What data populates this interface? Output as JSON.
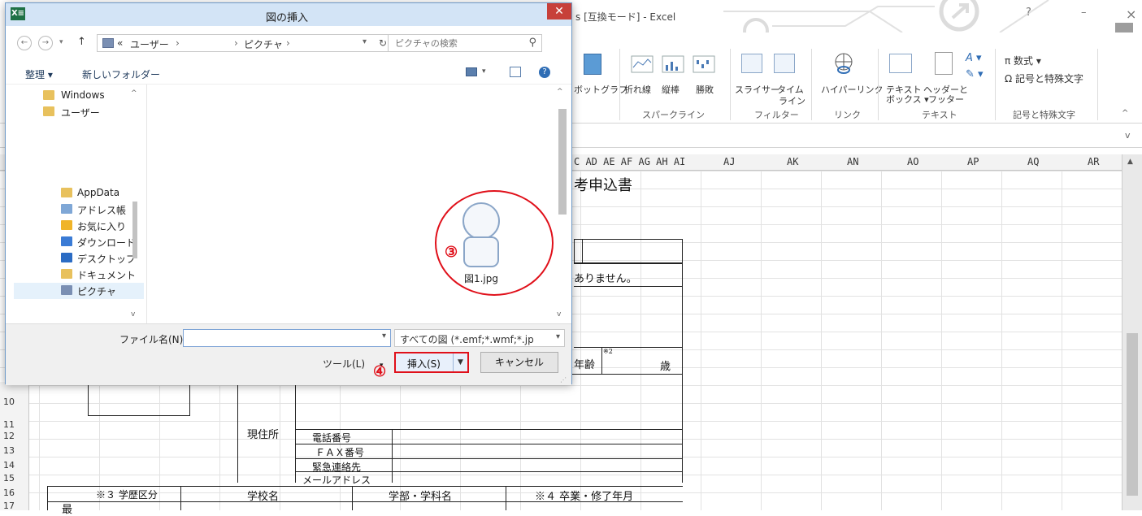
{
  "excel": {
    "title": "s [互換モード] - Excel",
    "window_controls": [
      "?",
      "–",
      "×"
    ],
    "ribbon": {
      "items": {
        "pivot_chart": "ボットグラフ",
        "line": "折れ線",
        "column": "縦棒",
        "winloss": "勝敗",
        "slicer": "スライサー",
        "timeline_1": "タイム",
        "timeline_2": "ライン",
        "hyperlink": "ハイパーリンク",
        "textbox_1": "テキスト",
        "textbox_2": "ボックス ▾",
        "header_1": "ヘッダーと",
        "header_2": "フッター",
        "equation": "π 数式 ▾",
        "symbol": "Ω 記号と特殊文字"
      },
      "groups": {
        "sparklines": "スパークライン",
        "filter": "フィルター",
        "link": "リンク",
        "text": "テキスト",
        "symbols": "記号と特殊文字"
      }
    },
    "columns_left": "C AD AE AF AG AH AI",
    "columns": [
      "AJ",
      "AK",
      "AN",
      "AO",
      "AP",
      "AQ",
      "AR"
    ],
    "rows": [
      "10",
      "11",
      "12",
      "13",
      "14",
      "15",
      "16",
      "17"
    ],
    "form": {
      "title_fragment": "考申込書",
      "notice_fragment": "ありません。",
      "age_label": "年齢",
      "age_note": "※2",
      "age_unit": "歳",
      "address_label": "現住所",
      "phone_label": "電話番号",
      "fax_label": "ＦＡＸ番号",
      "emergency_label": "緊急連絡先",
      "email_label": "メールアドレス",
      "edu_category": "※３ 学歴区分",
      "school_name": "学校名",
      "faculty": "学部・学科名",
      "graduation": "※４ 卒業・修了年月",
      "row17_char": "最"
    }
  },
  "dialog": {
    "title": "図の挿入",
    "app_icon": "X≡",
    "close": "✕",
    "nav": {
      "back": "←",
      "forward": "→",
      "up": "↑",
      "breadcrumb_prefix": "«",
      "crumb_1": "ユーザー",
      "crumb_2": "ピクチャ",
      "search_placeholder": "ピクチャの検索"
    },
    "toolbar": {
      "organize": "整理 ▾",
      "new_folder": "新しいフォルダー"
    },
    "tree": [
      "Windows",
      "ユーザー",
      "AppData",
      "アドレス帳",
      "お気に入り",
      "ダウンロード",
      "デスクトップ",
      "ドキュメント",
      "ピクチャ"
    ],
    "file": {
      "name": "図1.jpg"
    },
    "step3": "③",
    "step4": "④",
    "filename_label": "ファイル名(N):",
    "filename_value": "",
    "filter_value": "すべての図 (*.emf;*.wmf;*.jp",
    "tools_label": "ツール(L)",
    "insert_label": "挿入(S)",
    "cancel_label": "キャンセル"
  }
}
